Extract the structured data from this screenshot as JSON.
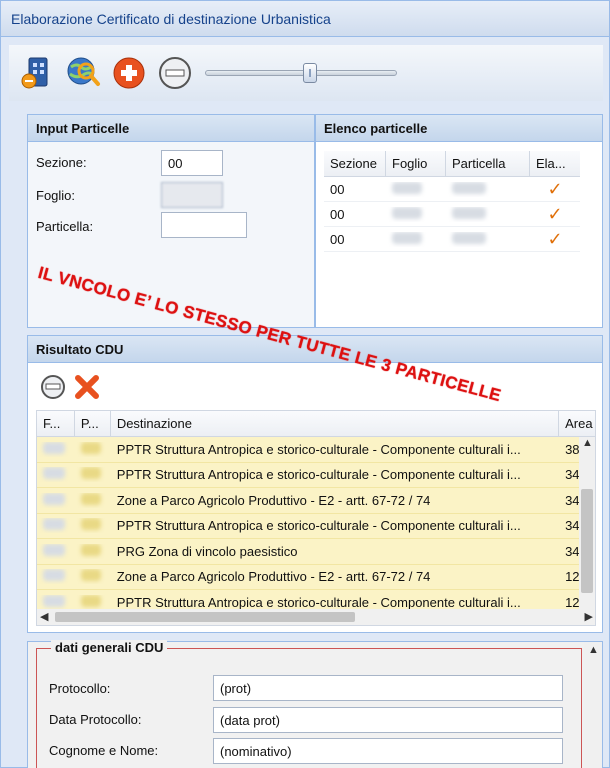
{
  "window": {
    "title": "Elaborazione Certificato di destinazione Urbanistica"
  },
  "toolbar": {
    "icons": [
      "building-icon",
      "globe-search-icon",
      "add-icon",
      "remove-icon"
    ],
    "zoom_percent": 55
  },
  "input_particelle": {
    "title": "Input Particelle",
    "sezione_label": "Sezione:",
    "sezione_value": "00",
    "foglio_label": "Foglio:",
    "particella_label": "Particella:"
  },
  "elenco": {
    "title": "Elenco particelle",
    "columns": [
      "Sezione",
      "Foglio",
      "Particella",
      "Ela..."
    ],
    "rows": [
      {
        "sezione": "00"
      },
      {
        "sezione": "00"
      },
      {
        "sezione": "00"
      }
    ]
  },
  "annotation": "IL VNCOLO E’ LO STESSO PER TUTTE LE 3 PARTICELLE",
  "risultato": {
    "title": "Risultato CDU",
    "columns": [
      "F...",
      "P...",
      "Destinazione",
      "Area"
    ],
    "rows": [
      {
        "dest": "PPTR Struttura Antropica e storico-culturale - Componente culturali i...",
        "area": "38"
      },
      {
        "dest": "PPTR Struttura Antropica e storico-culturale - Componente culturali i...",
        "area": "34"
      },
      {
        "dest": "Zone a Parco Agricolo Produttivo - E2 - artt. 67-72 / 74",
        "area": "34"
      },
      {
        "dest": "PPTR Struttura Antropica e storico-culturale - Componente culturali i...",
        "area": "34"
      },
      {
        "dest": "PRG Zona di vincolo paesistico",
        "area": "34"
      },
      {
        "dest": "Zone a Parco Agricolo Produttivo - E2 - artt. 67-72 / 74",
        "area": "12"
      },
      {
        "dest": "PPTR Struttura Antropica e storico-culturale - Componente culturali i...",
        "area": "12"
      }
    ]
  },
  "dati": {
    "legend": "dati generali CDU",
    "protocollo_label": "Protocollo:",
    "protocollo_value": "(prot)",
    "data_label": "Data Protocollo:",
    "data_value": "(data prot)",
    "nome_label": "Cognome e Nome:",
    "nome_value": "(nominativo)"
  },
  "colors": {
    "highlight_row": "#fbf3c6",
    "annotation": "#dd1111",
    "header_blue": "#15428b"
  }
}
